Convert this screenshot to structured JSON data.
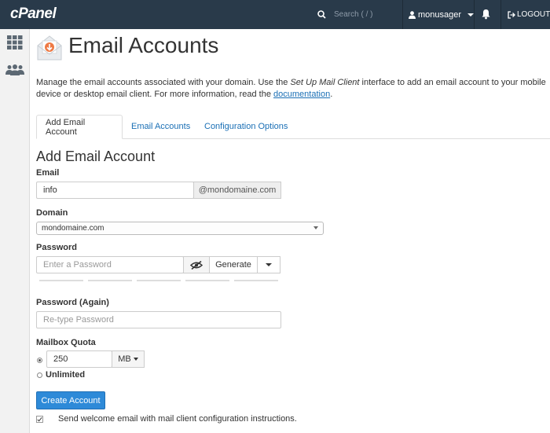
{
  "topbar": {
    "logo": "cPanel",
    "search_placeholder": "Search ( / )",
    "username": "monusager",
    "logout": "LOGOUT"
  },
  "page": {
    "title": "Email Accounts",
    "intro_1": "Manage the email accounts associated with your domain. Use the ",
    "intro_em": "Set Up Mail Client",
    "intro_2": " interface to add an email account to your mobile device or desktop email client. For more information, read the ",
    "intro_link": "documentation",
    "intro_3": "."
  },
  "tabs": [
    {
      "label": "Add Email Account",
      "active": true
    },
    {
      "label": "Email Accounts",
      "active": false
    },
    {
      "label": "Configuration Options",
      "active": false
    }
  ],
  "form": {
    "section_title": "Add Email Account",
    "email_label": "Email",
    "email_value": "info",
    "email_domain_suffix": "@mondomaine.com",
    "domain_label": "Domain",
    "domain_value": "mondomaine.com",
    "password_label": "Password",
    "password_placeholder": "Enter a Password",
    "generate_label": "Generate",
    "password_again_label": "Password (Again)",
    "password_again_placeholder": "Re-type Password",
    "quota_label": "Mailbox Quota",
    "quota_value": "250",
    "quota_unit": "MB",
    "unlimited_label": "Unlimited",
    "create_button": "Create Account",
    "welcome_label": "Send welcome email with mail client configuration instructions."
  },
  "colors": {
    "topbar": "#293a4a",
    "link": "#1a6fb5",
    "primary_button": "#2e8ad8"
  }
}
